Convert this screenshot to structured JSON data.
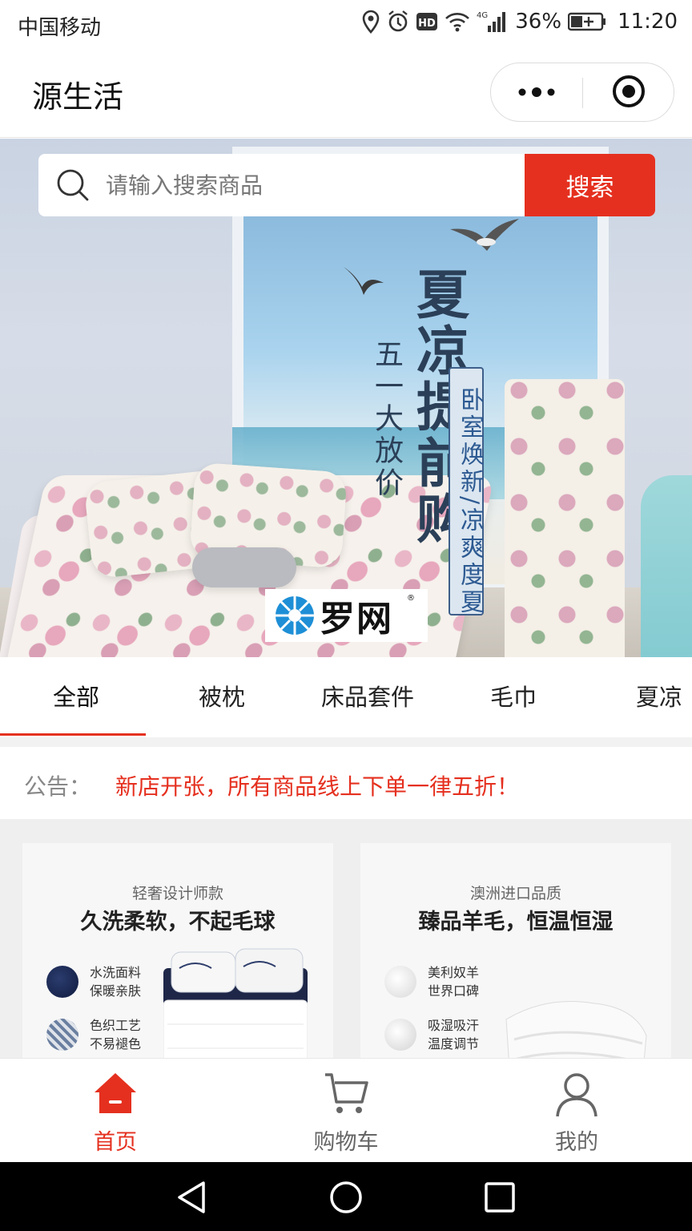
{
  "status_bar": {
    "carrier": "中国移动",
    "network": "4G",
    "battery": "36%",
    "time": "11:20",
    "icons": [
      "location-icon",
      "alarm-icon",
      "hd-icon",
      "wifi-icon",
      "signal-icon",
      "battery-icon"
    ]
  },
  "header": {
    "title": "源生活",
    "capsule_icons": [
      "more-icon",
      "close-icon"
    ]
  },
  "search": {
    "placeholder": "请输入搜索商品",
    "button_label": "搜索"
  },
  "banner": {
    "slogan_small": "五一大放价",
    "slogan_big": "夏凉提前购",
    "slogan_box": "卧室焕新/凉爽度夏",
    "watermark": "罗网"
  },
  "tabs": {
    "items": [
      "全部",
      "被枕",
      "床品套件",
      "毛巾",
      "夏凉"
    ],
    "active_index": 0
  },
  "notice": {
    "label": "公告：",
    "text": "新店开张，所有商品线上下单一律五折！"
  },
  "promos": [
    {
      "subtitle": "轻奢设计师款",
      "title": "久洗柔软，不起毛球",
      "features": [
        {
          "line1": "水洗面料",
          "line2": "保暖亲肤"
        },
        {
          "line1": "色织工艺",
          "line2": "不易褪色"
        }
      ]
    },
    {
      "subtitle": "澳洲进口品质",
      "title": "臻品羊毛，恒温恒湿",
      "features": [
        {
          "line1": "美利奴羊",
          "line2": "世界口碑"
        },
        {
          "line1": "吸湿吸汗",
          "line2": "温度调节"
        }
      ]
    }
  ],
  "bottom_nav": {
    "items": [
      {
        "label": "首页",
        "icon": "home-icon",
        "active": true
      },
      {
        "label": "购物车",
        "icon": "cart-icon",
        "active": false
      },
      {
        "label": "我的",
        "icon": "user-icon",
        "active": false
      }
    ]
  },
  "colors": {
    "accent": "#e5301f",
    "inactive": "#666666"
  }
}
